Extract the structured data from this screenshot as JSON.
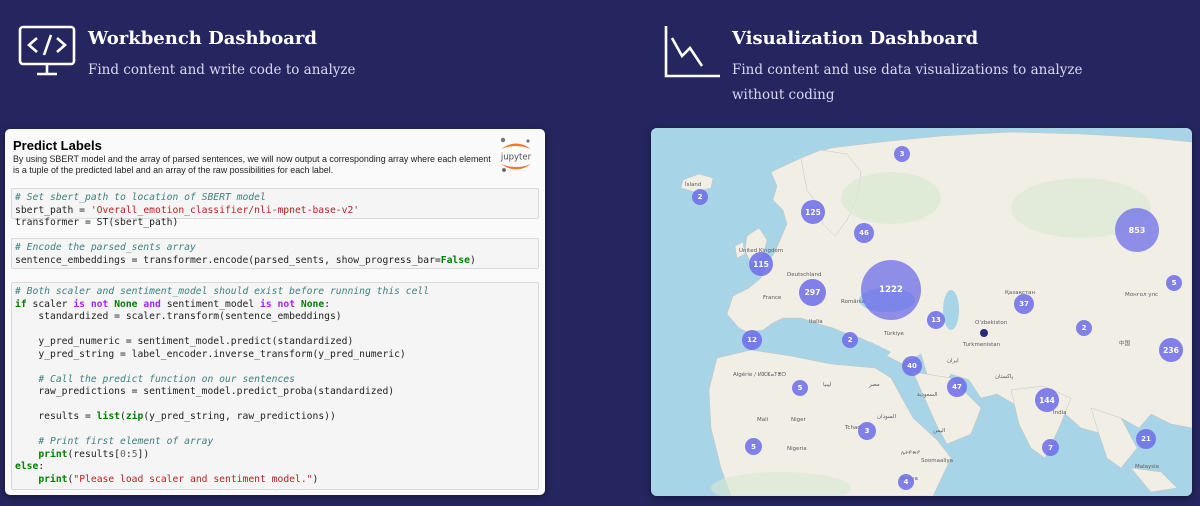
{
  "workbench": {
    "title": "Workbench Dashboard",
    "subtitle": "Find content and write code to analyze"
  },
  "visualization": {
    "title": "Visualization Dashboard",
    "subtitle": "Find content and use data visualizations to analyze without coding"
  },
  "notebook": {
    "title": "Predict Labels",
    "description": "By using SBERT model and the array of parsed sentences, we will now output a corresponding array where each element is a tuple of the predicted label and an array of the raw possibilities for each label.",
    "logo_text": "jupyter",
    "cell1": [
      "# Set sbert_path to location of SBERT model",
      "sbert_path = 'Overall_emotion_classifier/nli-mpnet-base-v2'",
      "transformer = ST(sbert_path)"
    ],
    "cell2": [
      "# Encode the parsed_sents array",
      "sentence_embeddings = transformer.encode(parsed_sents, show_progress_bar=False)"
    ],
    "cell3": [
      "# Both scaler and sentiment_model should exist before running this cell",
      "if scaler is not None and sentiment_model is not None:",
      "    standardized = scaler.transform(sentence_embeddings)",
      "",
      "    y_pred_numeric = sentiment_model.predict(standardized)",
      "    y_pred_string = label_encoder.inverse_transform(y_pred_numeric)",
      "",
      "    # Call the predict function on our sentences",
      "    raw_predictions = sentiment_model.predict_proba(standardized)",
      "",
      "    results = list(zip(y_pred_string, raw_predictions))",
      "",
      "    # Print first element of array",
      "    print(results[0:5])",
      "else:",
      "    print(\"Please load scaler and sentiment model.\")"
    ]
  },
  "map": {
    "clusters": [
      {
        "label": "3",
        "size": "small"
      },
      {
        "label": "2",
        "size": "small"
      },
      {
        "label": "125",
        "size": "medium"
      },
      {
        "label": "46",
        "size": "small"
      },
      {
        "label": "853",
        "size": "large"
      },
      {
        "label": "115",
        "size": "medium"
      },
      {
        "label": "297",
        "size": "medium"
      },
      {
        "label": "1222",
        "size": "xlarge"
      },
      {
        "label": "5",
        "size": "small"
      },
      {
        "label": "37",
        "size": "small"
      },
      {
        "label": "13",
        "size": "small"
      },
      {
        "label": "2",
        "size": "small"
      },
      {
        "label": "12",
        "size": "small"
      },
      {
        "label": "2",
        "size": "small"
      },
      {
        "label": "236",
        "size": "medium"
      },
      {
        "label": "40",
        "size": "small"
      },
      {
        "label": "5",
        "size": "small"
      },
      {
        "label": "47",
        "size": "small"
      },
      {
        "label": "144",
        "size": "medium"
      },
      {
        "label": "3",
        "size": "small"
      },
      {
        "label": "5",
        "size": "small"
      },
      {
        "label": "7",
        "size": "small"
      },
      {
        "label": "21",
        "size": "small"
      },
      {
        "label": "4",
        "size": "small"
      }
    ],
    "place_labels": [
      "Ísland",
      "United Kingdom",
      "Deutschland",
      "France",
      "România",
      "Italia",
      "Türkiye",
      "Қазақстан",
      "O'zbekiston",
      "Turkmenistan",
      "ایران",
      "Монгол улс",
      "中国",
      "Algérie / ⵍⵣⵣⴰⵢⴻⵔ",
      "ليبيا",
      "مصر",
      "Mali",
      "Niger",
      "Tchad",
      "Nigeria",
      "السعودية",
      "Soomaaliya",
      "Kenya",
      "Malaysia",
      "India",
      "پاکستان",
      "ኢትዮጵያ",
      "اليمن",
      "السودان"
    ]
  },
  "colors": {
    "background": "#252660",
    "cluster": "#6c6ce8",
    "water": "#a8d4e8",
    "land": "#f1eee6"
  }
}
